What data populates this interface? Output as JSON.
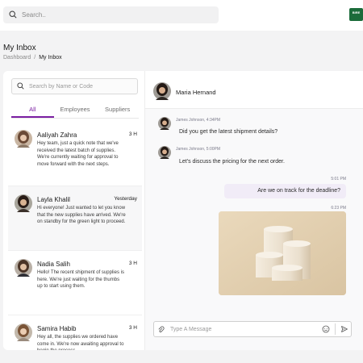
{
  "topbar": {
    "search_placeholder": "Search..",
    "brand_label": "BIRE",
    "brand_color": "#1b6b3a"
  },
  "page": {
    "title": "My Inbox",
    "breadcrumb": {
      "root": "Dashboard",
      "separator": "/",
      "current": "My Inbox"
    }
  },
  "sidebar": {
    "search_placeholder": "Search by Name or Code",
    "tabs": [
      {
        "label": "All",
        "active": true
      },
      {
        "label": "Employees",
        "active": false
      },
      {
        "label": "Suppliers",
        "active": false
      }
    ],
    "conversations": [
      {
        "name": "Aaliyah Zahra",
        "time": "3 H",
        "preview": "Hey team, just a quick note that we've received the latest batch of supplies. We're currently waiting for approval to move forward with the next steps."
      },
      {
        "name": "Layla Khalil",
        "time": "Yesterday",
        "preview": "Hi everyone! Just wanted to let you know that the new supplies have arrived. We're on standby for the green light to proceed."
      },
      {
        "name": "Nadia Salih",
        "time": "3 H",
        "preview": "Hello! The recent shipment of supplies is here. We're just waiting for the thumbs up to start using them."
      },
      {
        "name": "Samira Habib",
        "time": "3 H",
        "preview": "Hey all, the supplies we ordered have come in. We're now awaiting approval to begin the process."
      }
    ]
  },
  "chat": {
    "contact_name": "Maria Hernand",
    "messages": [
      {
        "sender": "James Johnson, 4:34PM",
        "text": "Did you get the latest shipment details?"
      },
      {
        "sender": "James Johnson, 5:00PM",
        "text": "Let's discuss the pricing for the next order."
      }
    ],
    "outgoing": {
      "time": "5:01 PM",
      "text": "Are we on track for the deadline?",
      "image_time": "6:23 PM"
    },
    "composer_placeholder": "Type A Message"
  },
  "colors": {
    "accent": "#7b1fa2",
    "outgoing_bubble": "#f1ecf7"
  }
}
